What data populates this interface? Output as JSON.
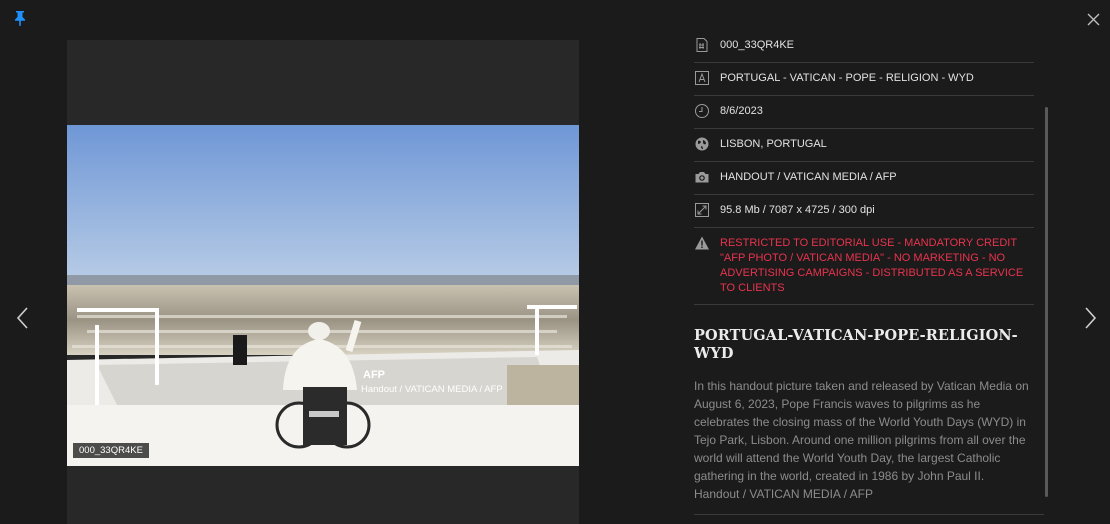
{
  "icons": {
    "pin": "pin-icon",
    "close": "close-icon",
    "prev": "chevron-left-icon",
    "next": "chevron-right-icon"
  },
  "colors": {
    "accent": "#1e90ff",
    "warning": "#e8344e",
    "background": "#1b1b1b"
  },
  "photo": {
    "afp_logo": "AFP",
    "credit_overlay": "Handout / VATICAN MEDIA / AFP",
    "id_chip": "000_33QR4KE"
  },
  "metadata": {
    "id": "000_33QR4KE",
    "keywords": "PORTUGAL - VATICAN - POPE - RELIGION - WYD",
    "date": "8/6/2023",
    "location": "LISBON, PORTUGAL",
    "credit": "HANDOUT / VATICAN MEDIA / AFP",
    "file_info": "95.8 Mb / 7087 x 4725 / 300 dpi",
    "restriction": "RESTRICTED TO EDITORIAL USE - MANDATORY CREDIT \"AFP PHOTO / VATICAN MEDIA\" - NO MARKETING - NO ADVERTISING CAMPAIGNS - DISTRIBUTED AS A SERVICE TO CLIENTS"
  },
  "story": {
    "title": "PORTUGAL-VATICAN-POPE-RELIGION-WYD",
    "caption": "In this handout picture taken and released by Vatican Media on August 6, 2023, Pope Francis waves to pilgrims as he celebrates the closing mass of the World Youth Days (WYD) in Tejo Park, Lisbon. Around one million pilgrims from all over the world will attend the World Youth Day, the largest Catholic gathering in the world, created in 1986 by John Paul II.",
    "byline": "Handout / VATICAN MEDIA / AFP"
  }
}
